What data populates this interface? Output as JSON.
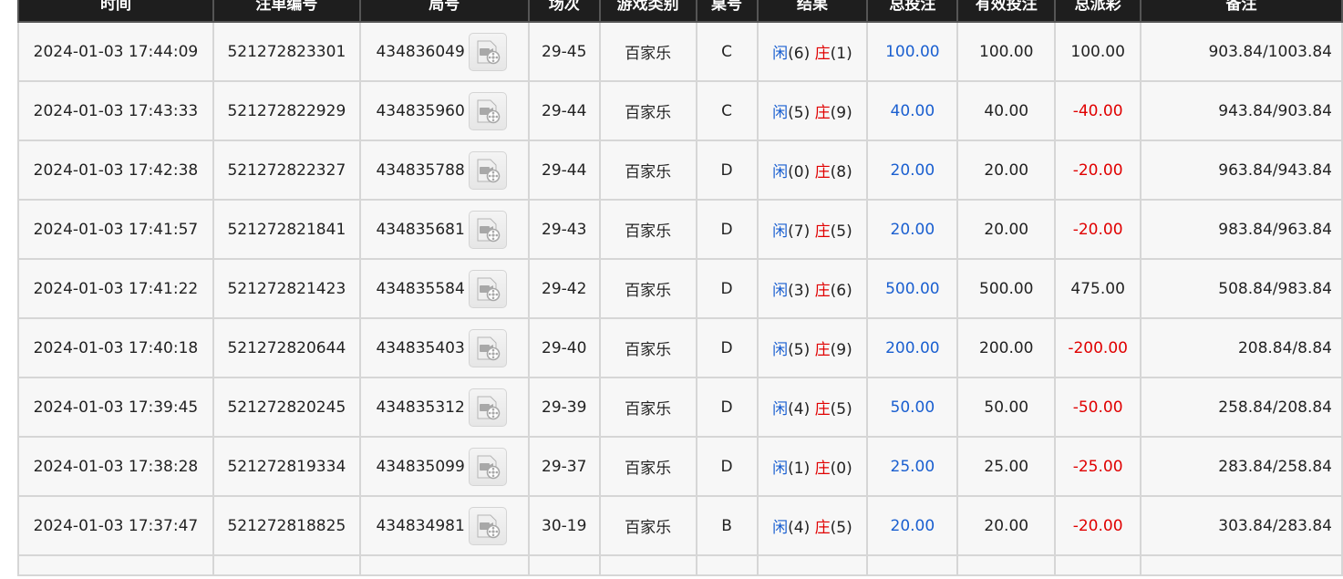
{
  "table": {
    "headers": [
      "时间",
      "注单编号",
      "局号",
      "场次",
      "游戏类别",
      "桌号",
      "结果",
      "总投注",
      "有效投注",
      "总派彩",
      "备注"
    ],
    "result_prefix_player": "闲",
    "result_prefix_banker": "庄",
    "rows": [
      {
        "time": "2024-01-03 17:44:09",
        "bet_id": "521272823301",
        "round_id": "434836049",
        "session": "29-45",
        "game": "百家乐",
        "table": "C",
        "player": "(6)",
        "banker": "(1)",
        "total_bet": "100.00",
        "valid_bet": "100.00",
        "payout": "100.00",
        "payout_negative": false,
        "remark": "903.84/1003.84"
      },
      {
        "time": "2024-01-03 17:43:33",
        "bet_id": "521272822929",
        "round_id": "434835960",
        "session": "29-44",
        "game": "百家乐",
        "table": "C",
        "player": "(5)",
        "banker": "(9)",
        "total_bet": "40.00",
        "valid_bet": "40.00",
        "payout": "-40.00",
        "payout_negative": true,
        "remark": "943.84/903.84"
      },
      {
        "time": "2024-01-03 17:42:38",
        "bet_id": "521272822327",
        "round_id": "434835788",
        "session": "29-44",
        "game": "百家乐",
        "table": "D",
        "player": "(0)",
        "banker": "(8)",
        "total_bet": "20.00",
        "valid_bet": "20.00",
        "payout": "-20.00",
        "payout_negative": true,
        "remark": "963.84/943.84"
      },
      {
        "time": "2024-01-03 17:41:57",
        "bet_id": "521272821841",
        "round_id": "434835681",
        "session": "29-43",
        "game": "百家乐",
        "table": "D",
        "player": "(7)",
        "banker": "(5)",
        "total_bet": "20.00",
        "valid_bet": "20.00",
        "payout": "-20.00",
        "payout_negative": true,
        "remark": "983.84/963.84"
      },
      {
        "time": "2024-01-03 17:41:22",
        "bet_id": "521272821423",
        "round_id": "434835584",
        "session": "29-42",
        "game": "百家乐",
        "table": "D",
        "player": "(3)",
        "banker": "(6)",
        "total_bet": "500.00",
        "valid_bet": "500.00",
        "payout": "475.00",
        "payout_negative": false,
        "remark": "508.84/983.84"
      },
      {
        "time": "2024-01-03 17:40:18",
        "bet_id": "521272820644",
        "round_id": "434835403",
        "session": "29-40",
        "game": "百家乐",
        "table": "D",
        "player": "(5)",
        "banker": "(9)",
        "total_bet": "200.00",
        "valid_bet": "200.00",
        "payout": "-200.00",
        "payout_negative": true,
        "remark": "208.84/8.84"
      },
      {
        "time": "2024-01-03 17:39:45",
        "bet_id": "521272820245",
        "round_id": "434835312",
        "session": "29-39",
        "game": "百家乐",
        "table": "D",
        "player": "(4)",
        "banker": "(5)",
        "total_bet": "50.00",
        "valid_bet": "50.00",
        "payout": "-50.00",
        "payout_negative": true,
        "remark": "258.84/208.84"
      },
      {
        "time": "2024-01-03 17:38:28",
        "bet_id": "521272819334",
        "round_id": "434835099",
        "session": "29-37",
        "game": "百家乐",
        "table": "D",
        "player": "(1)",
        "banker": "(0)",
        "total_bet": "25.00",
        "valid_bet": "25.00",
        "payout": "-25.00",
        "payout_negative": true,
        "remark": "283.84/258.84"
      },
      {
        "time": "2024-01-03 17:37:47",
        "bet_id": "521272818825",
        "round_id": "434834981",
        "session": "30-19",
        "game": "百家乐",
        "table": "B",
        "player": "(4)",
        "banker": "(5)",
        "total_bet": "20.00",
        "valid_bet": "20.00",
        "payout": "-20.00",
        "payout_negative": true,
        "remark": "303.84/283.84"
      }
    ]
  },
  "colors": {
    "header_bg": "#1e1e1e",
    "header_text": "#ffffff",
    "row_bg": "#f7f7f7",
    "grid": "#d6d6d6",
    "player_blue": "#1a5fd0",
    "negative_red": "#e00000"
  },
  "icons": {
    "replay": "video-replay-icon"
  }
}
